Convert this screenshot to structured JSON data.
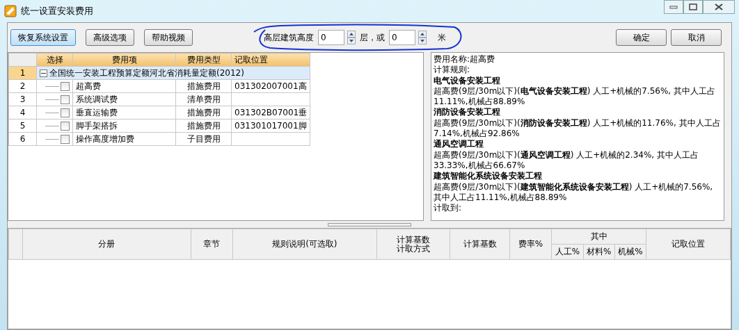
{
  "window": {
    "title": "统一设置安装费用"
  },
  "toolbar": {
    "buttons": [
      {
        "label": "恢复系统设置",
        "focused": true
      },
      {
        "label": "高级选项",
        "focused": false
      },
      {
        "label": "帮助视频",
        "focused": false
      }
    ],
    "height_label": "高层建筑高度",
    "floors_value": "0",
    "floors_unit": "层，或",
    "meters_value": "0",
    "meters_unit": "米",
    "actions": [
      "确定",
      "取消"
    ]
  },
  "fee_table": {
    "columns": [
      "选择",
      "费用项",
      "费用类型",
      "记取位置"
    ],
    "rows": [
      {
        "number": "1",
        "kind": "group",
        "label": "全国统一安装工程预算定额河北省消耗量定额(2012)",
        "expanded": true,
        "selected": true
      },
      {
        "number": "2",
        "kind": "item",
        "checked": false,
        "name": "超高费",
        "type": "措施费用",
        "location": "031302007001高",
        "selected": false
      },
      {
        "number": "3",
        "kind": "item",
        "checked": false,
        "name": "系统调试费",
        "type": "清单费用",
        "location": "",
        "selected": false
      },
      {
        "number": "4",
        "kind": "item",
        "checked": false,
        "name": "垂直运输费",
        "type": "措施费用",
        "location": "031302B07001垂",
        "selected": false
      },
      {
        "number": "5",
        "kind": "item",
        "checked": false,
        "name": "脚手架搭拆",
        "type": "措施费用",
        "location": "031301017001脚",
        "selected": false
      },
      {
        "number": "6",
        "kind": "item",
        "checked": false,
        "name": "操作高度增加费",
        "type": "子目费用",
        "location": "",
        "selected": false
      }
    ]
  },
  "details": [
    {
      "kind": "plain",
      "text": "费用名称:超高费"
    },
    {
      "kind": "plain",
      "text": "计算规则:"
    },
    {
      "kind": "heading",
      "text": "电气设备安装工程"
    },
    {
      "kind": "plain",
      "text": "超高费(9层/30m以下)(**电气设备安装工程**) 人工+机械的7.56%, 其中人工占11.11%,机械占88.89%"
    },
    {
      "kind": "heading",
      "text": "消防设备安装工程"
    },
    {
      "kind": "plain",
      "text": "超高费(9层/30m以下)(**消防设备安装工程**) 人工+机械的11.76%, 其中人工占7.14%,机械占92.86%"
    },
    {
      "kind": "heading",
      "text": "通风空调工程"
    },
    {
      "kind": "plain",
      "text": "超高费(9层/30m以下)(**通风空调工程**) 人工+机械的2.34%, 其中人工占33.33%,机械占66.67%"
    },
    {
      "kind": "heading",
      "text": "建筑智能化系统设备安装工程"
    },
    {
      "kind": "plain",
      "text": "超高费(9层/30m以下)(**建筑智能化系统设备安装工程**) 人工+机械的7.56%, 其中人工占11.11%,机械占88.89%"
    },
    {
      "kind": "plain",
      "text": "计取到:"
    }
  ],
  "rule_table": {
    "columns": [
      {
        "label": "分册"
      },
      {
        "label": "章节"
      },
      {
        "label": "规则说明(可选取)"
      },
      {
        "lines": [
          "计算基数",
          "计取方式"
        ]
      },
      {
        "label": "计算基数"
      },
      {
        "label": "费率%"
      },
      {
        "label": "其中",
        "children": [
          "人工%",
          "材料%",
          "机械%"
        ]
      },
      {
        "label": "记取位置"
      }
    ]
  }
}
